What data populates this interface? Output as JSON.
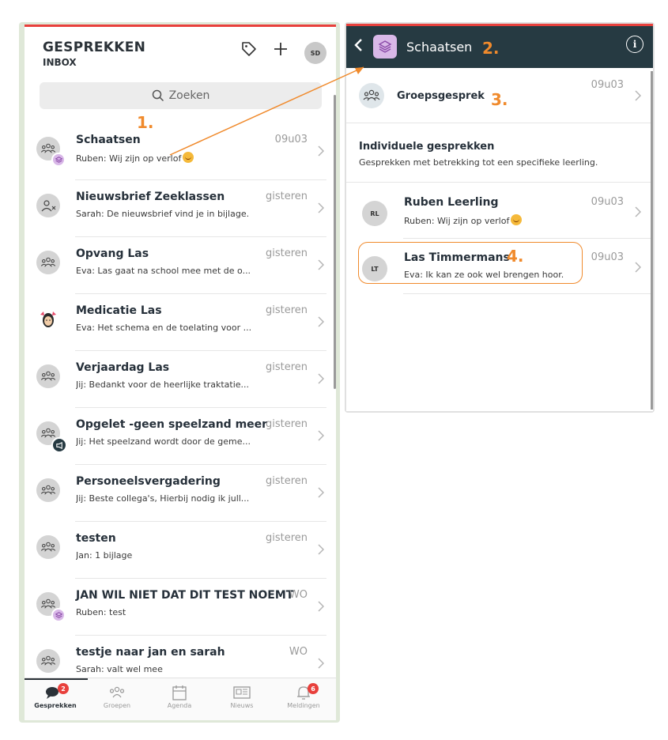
{
  "left": {
    "title": "GESPREKKEN",
    "subtitle": "INBOX",
    "search_placeholder": "Zoeken",
    "avatar": "SD",
    "conversations": [
      {
        "name": "Schaatsen",
        "message": "Ruben: Wij zijn op verlof",
        "emoji": true,
        "time": "09u03",
        "icon": "group-icon",
        "badge": "school-badge"
      },
      {
        "name": "Nieuwsbrief Zeeklassen",
        "message": "Sarah: De nieuwsbrief vind je in bijlage.",
        "time": "gisteren",
        "icon": "person-x-icon"
      },
      {
        "name": "Opvang Las",
        "message": "Eva: Las gaat na school mee met de o...",
        "time": "gisteren",
        "icon": "group-icon"
      },
      {
        "name": "Medicatie Las",
        "message": "Eva: Het schema en de toelating voor ...",
        "time": "gisteren",
        "icon": "child-avatar"
      },
      {
        "name": "Verjaardag Las",
        "message": "Jij: Bedankt voor de heerlijke traktatie...",
        "time": "gisteren",
        "icon": "group-icon"
      },
      {
        "name": "Opgelet -geen speelzand meer",
        "message": "Jij: Het speelzand wordt door de geme...",
        "time": "gisteren",
        "icon": "group-icon",
        "badge": "megaphone-badge"
      },
      {
        "name": "Personeelsvergadering",
        "message": "Jij: Beste collega's, Hierbij nodig ik jull...",
        "time": "gisteren",
        "icon": "group-icon"
      },
      {
        "name": "testen",
        "message": "Jan: 1 bijlage",
        "time": "gisteren",
        "icon": "group-icon"
      },
      {
        "name": "JAN WIL NIET DAT DIT TEST NOEMT",
        "message": "Ruben: test",
        "time": "WO",
        "icon": "group-icon",
        "badge": "school-badge"
      },
      {
        "name": "testje naar jan en sarah",
        "message": "Sarah: valt wel mee",
        "time": "WO",
        "icon": "group-icon"
      }
    ],
    "tabs": [
      {
        "label": "Gesprekken",
        "badge": "2",
        "icon": "chat-icon",
        "active": true
      },
      {
        "label": "Groepen",
        "icon": "groups-icon"
      },
      {
        "label": "Agenda",
        "icon": "calendar-icon"
      },
      {
        "label": "Nieuws",
        "icon": "news-icon"
      },
      {
        "label": "Meldingen",
        "badge": "6",
        "icon": "bell-icon"
      }
    ]
  },
  "right": {
    "title": "Schaatsen",
    "group_row": {
      "name": "Groepsgesprek",
      "time": "09u03"
    },
    "individual_title": "Individuele gesprekken",
    "individual_sub": "Gesprekken met betrekking tot een specifieke leerling.",
    "people": [
      {
        "initials": "RL",
        "name": "Ruben Leerling",
        "message": "Ruben: Wij zijn op verlof",
        "emoji": true,
        "time": "09u03"
      },
      {
        "initials": "LT",
        "name": "Las Timmermans",
        "message": "Eva: Ik kan ze ook wel brengen hoor.",
        "time": "09u03"
      }
    ]
  },
  "steps": [
    "1.",
    "2.",
    "3.",
    "4."
  ],
  "colors": {
    "accent": "#f08a2c",
    "header_dark": "#263a42",
    "top_red": "#e8403c",
    "group_purple": "#d9b8e8"
  }
}
